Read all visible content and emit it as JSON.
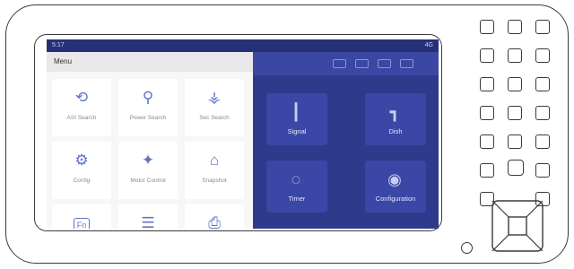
{
  "status": {
    "time": "5:17",
    "signal": "4G"
  },
  "menu": {
    "title": "Menu",
    "items": [
      {
        "label": "ASI Search",
        "icon": "search-icon"
      },
      {
        "label": "Power Search",
        "icon": "power-search-icon"
      },
      {
        "label": "Sec Search",
        "icon": "antenna-icon"
      },
      {
        "label": "Config",
        "icon": "gear-icon"
      },
      {
        "label": "Motor Control",
        "icon": "satellite-dish-icon"
      },
      {
        "label": "Snapshot",
        "icon": "camera-icon"
      },
      {
        "label": "Fn",
        "icon": "fn-icon"
      },
      {
        "label": "",
        "icon": "sliders-icon"
      },
      {
        "label": "",
        "icon": "printer-icon"
      }
    ]
  },
  "background_tiles": [
    {
      "label": "Signal",
      "icon": "pin-icon"
    },
    {
      "label": "Dish",
      "icon": "dish-icon"
    },
    {
      "label": "Timer",
      "icon": "timer-icon"
    },
    {
      "label": "Configuration",
      "icon": "target-icon"
    }
  ],
  "colors": {
    "screen_blue": "#2e3b8c",
    "menu_bg": "#f7f7f8",
    "accent": "#6272c9"
  }
}
